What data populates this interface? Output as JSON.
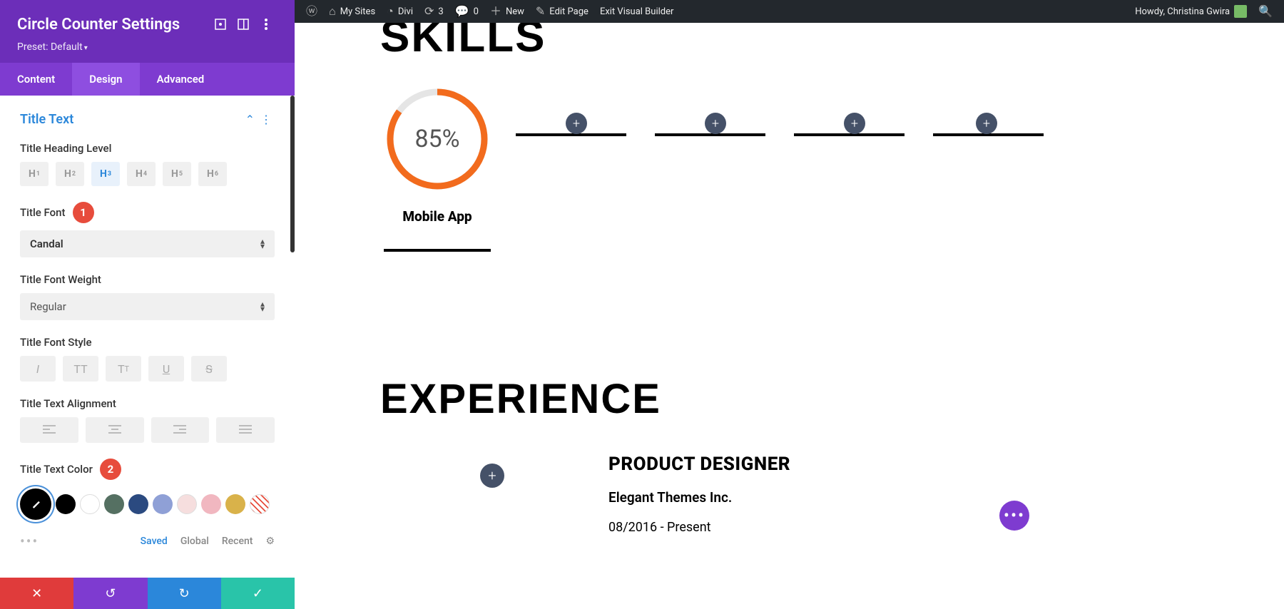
{
  "adminbar": {
    "mysites": "My Sites",
    "divi": "Divi",
    "updates": "3",
    "comments": "0",
    "new": "New",
    "edit": "Edit Page",
    "exit": "Exit Visual Builder",
    "howdy": "Howdy, Christina Gwira"
  },
  "panel": {
    "title": "Circle Counter Settings",
    "preset": "Preset: Default",
    "tabs": {
      "content": "Content",
      "design": "Design",
      "advanced": "Advanced"
    },
    "section": "Title Text",
    "heading_level_label": "Title Heading Level",
    "heading_levels": [
      "H1",
      "H2",
      "H3",
      "H4",
      "H5",
      "H6"
    ],
    "heading_active": "H3",
    "title_font_label": "Title Font",
    "title_font_value": "Candal",
    "title_font_weight_label": "Title Font Weight",
    "title_font_weight_value": "Regular",
    "title_font_style_label": "Title Font Style",
    "title_align_label": "Title Text Alignment",
    "title_color_label": "Title Text Color",
    "badge1": "1",
    "badge2": "2",
    "color_tabs": {
      "saved": "Saved",
      "global": "Global",
      "recent": "Recent"
    },
    "colors": {
      "palette": [
        "#000000",
        "#ffffff",
        "#557062",
        "#2b4a80",
        "#8fa0d6",
        "#f6dede",
        "#f1b7c0",
        "#d9b24a"
      ]
    }
  },
  "canvas": {
    "skills": "SKILLS",
    "experience": "EXPERIENCE",
    "circle": {
      "percent": "85%",
      "label": "Mobile App",
      "value": 85
    },
    "job": {
      "title": "PRODUCT DESIGNER",
      "company": "Elegant Themes Inc.",
      "dates": "08/2016 - Present"
    }
  },
  "chart_data": {
    "type": "pie",
    "title": "Mobile App",
    "values": [
      85,
      15
    ],
    "categories": [
      "complete",
      "remaining"
    ],
    "colors": [
      "#f26b1d",
      "#e5e5e5"
    ]
  }
}
